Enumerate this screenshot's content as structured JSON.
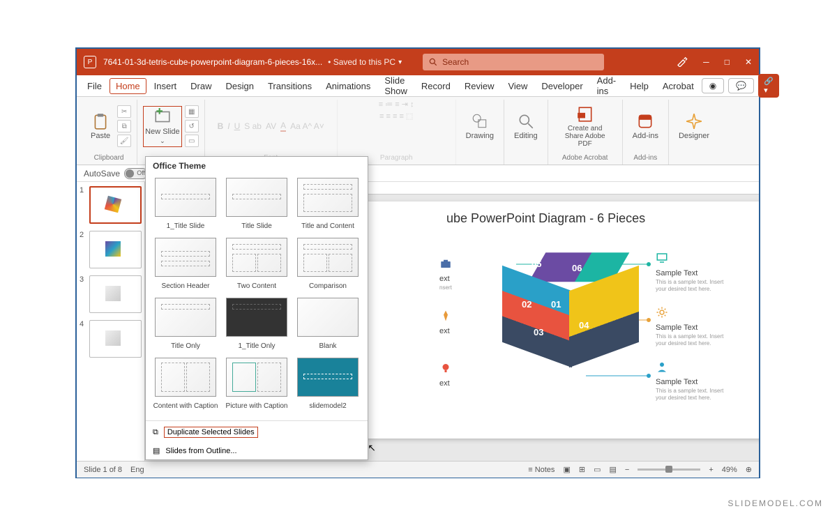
{
  "titlebar": {
    "doc_name": "7641-01-3d-tetris-cube-powerpoint-diagram-6-pieces-16x...",
    "saved_status": "Saved to this PC",
    "search_placeholder": "Search"
  },
  "menu": {
    "items": [
      "File",
      "Home",
      "Insert",
      "Draw",
      "Design",
      "Transitions",
      "Animations",
      "Slide Show",
      "Record",
      "Review",
      "View",
      "Developer",
      "Add-ins",
      "Help",
      "Acrobat"
    ]
  },
  "ribbon": {
    "clipboard_label": "Clipboard",
    "paste": "Paste",
    "new_slide": "New Slide",
    "font_label": "Font",
    "paragraph_label": "Paragraph",
    "drawing": "Drawing",
    "editing": "Editing",
    "adobe": "Create and Share Adobe PDF",
    "adobe_group": "Adobe Acrobat",
    "addins": "Add-ins",
    "addins_group": "Add-ins",
    "designer": "Designer"
  },
  "autosave": {
    "label": "AutoSave",
    "state": "Off"
  },
  "thumbs": {
    "count": 4
  },
  "slide": {
    "title": "ube PowerPoint Diagram - 6 Pieces",
    "item_title": "Sample Text",
    "item_desc": "This is a sample text. Insert your desired text here.",
    "partial_ext": "ext",
    "cube_numbers": [
      "01",
      "02",
      "03",
      "04",
      "05",
      "06"
    ]
  },
  "gallery": {
    "header": "Office Theme",
    "layouts": [
      "1_Title Slide",
      "Title Slide",
      "Title and Content",
      "Section Header",
      "Two Content",
      "Comparison",
      "Title Only",
      "1_Title Only",
      "Blank",
      "Content with Caption",
      "Picture with Caption",
      "slidemodel2"
    ],
    "dup": "Duplicate Selected Slides",
    "outline": "Slides from Outline..."
  },
  "status": {
    "slide": "Slide 1 of 8",
    "lang": "Eng",
    "notes": "Notes",
    "zoom": "49%"
  },
  "watermark": "SLIDEMODEL.COM"
}
